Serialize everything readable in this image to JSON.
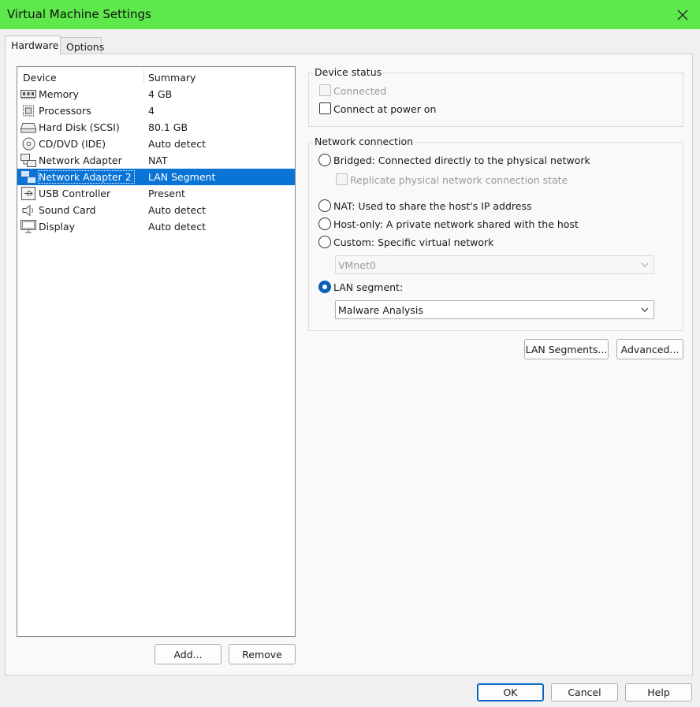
{
  "window": {
    "title": "Virtual Machine Settings"
  },
  "tabs": [
    {
      "label": "Hardware",
      "active": true
    },
    {
      "label": "Options",
      "active": false
    }
  ],
  "device_list": {
    "headers": {
      "device": "Device",
      "summary": "Summary"
    },
    "items": [
      {
        "icon": "memory-icon",
        "name": "Memory",
        "summary": "4 GB"
      },
      {
        "icon": "processor-icon",
        "name": "Processors",
        "summary": "4"
      },
      {
        "icon": "hard-disk-icon",
        "name": "Hard Disk (SCSI)",
        "summary": "80.1 GB"
      },
      {
        "icon": "cd-dvd-icon",
        "name": "CD/DVD (IDE)",
        "summary": "Auto detect"
      },
      {
        "icon": "network-adapter-icon",
        "name": "Network Adapter",
        "summary": "NAT"
      },
      {
        "icon": "network-adapter-icon",
        "name": "Network Adapter 2",
        "summary": "LAN Segment",
        "selected": true
      },
      {
        "icon": "usb-icon",
        "name": "USB Controller",
        "summary": "Present"
      },
      {
        "icon": "speaker-icon",
        "name": "Sound Card",
        "summary": "Auto detect"
      },
      {
        "icon": "monitor-icon",
        "name": "Display",
        "summary": "Auto detect"
      }
    ]
  },
  "list_buttons": {
    "add": "Add...",
    "remove": "Remove"
  },
  "device_status": {
    "label": "Device status",
    "connected": {
      "label": "Connected",
      "checked": false,
      "enabled": false
    },
    "connect_at_power_on": {
      "label": "Connect at power on",
      "checked": false
    }
  },
  "network_connection": {
    "label": "Network connection",
    "bridged": {
      "label": "Bridged: Connected directly to the physical network",
      "selected": false
    },
    "replicate": {
      "label": "Replicate physical network connection state",
      "checked": false,
      "enabled": false
    },
    "nat": {
      "label": "NAT: Used to share the host's IP address",
      "selected": false
    },
    "host_only": {
      "label": "Host-only: A private network shared with the host",
      "selected": false
    },
    "custom": {
      "label": "Custom: Specific virtual network",
      "selected": false
    },
    "custom_network": {
      "value": "VMnet0",
      "enabled": false
    },
    "lan_segment": {
      "label": "LAN segment:",
      "selected": true
    },
    "lan_segment_value": {
      "value": "Malware Analysis"
    }
  },
  "network_buttons": {
    "lan_segments": "LAN Segments...",
    "advanced": "Advanced..."
  },
  "footer": {
    "ok": "OK",
    "cancel": "Cancel",
    "help": "Help"
  },
  "colors": {
    "titlebar": "#5ee84b",
    "selection": "#0a74d6",
    "accent": "#0a5fb4"
  }
}
